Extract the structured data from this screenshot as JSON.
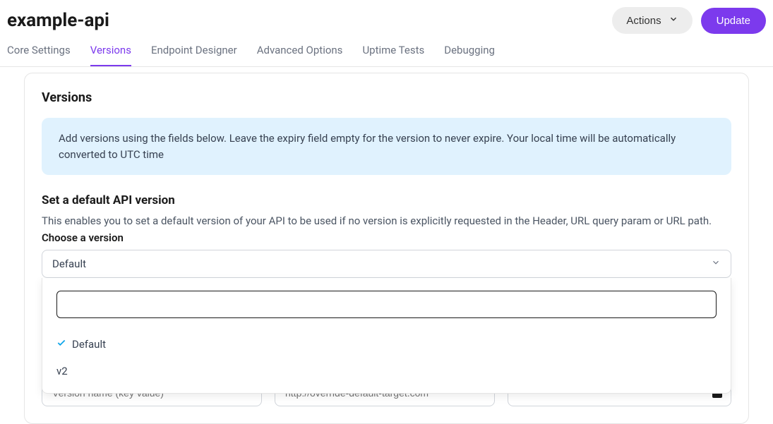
{
  "header": {
    "title": "example-api",
    "actions_label": "Actions",
    "update_label": "Update"
  },
  "tabs": [
    {
      "label": "Core Settings",
      "active": false
    },
    {
      "label": "Versions",
      "active": true
    },
    {
      "label": "Endpoint Designer",
      "active": false
    },
    {
      "label": "Advanced Options",
      "active": false
    },
    {
      "label": "Uptime Tests",
      "active": false
    },
    {
      "label": "Debugging",
      "active": false
    }
  ],
  "versions": {
    "title": "Versions",
    "info": "Add versions using the fields below. Leave the expiry field empty for the version to never expire. Your local time will be automatically converted to UTC time",
    "default_section_title": "Set a default API version",
    "default_section_desc": "This enables you to set a default version of your API to be used if no version is explicitly requested in the Header, URL query param or URL path.",
    "choose_label": "Choose a version",
    "selected": "Default",
    "dropdown_search": "",
    "options": [
      {
        "label": "Default",
        "selected": true
      },
      {
        "label": "v2",
        "selected": false
      }
    ],
    "name_placeholder": "Version name (key value)",
    "url_placeholder": "http://override-default-target.com"
  }
}
